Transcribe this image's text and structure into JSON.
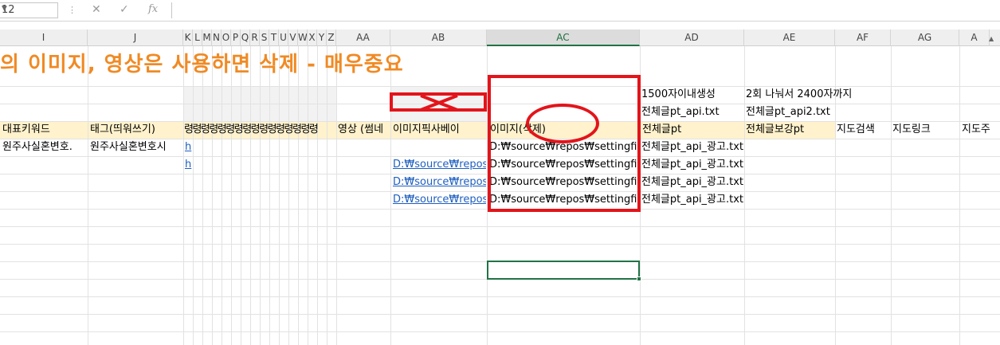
{
  "formula_bar": {
    "name_box_value": "12",
    "cancel_icon": "close-icon",
    "enter_icon": "check-icon",
    "function_icon": "fx-icon",
    "formula_value": ""
  },
  "columns": [
    "I",
    "J",
    "K",
    "L",
    "M",
    "N",
    "O",
    "P",
    "Q",
    "R",
    "S",
    "T",
    "U",
    "V",
    "W",
    "X",
    "Y",
    "Z",
    "AA",
    "AB",
    "AC",
    "AD",
    "AE",
    "AF",
    "AG",
    "A"
  ],
  "selected_column": "AC",
  "rows": {
    "title": "의 이미지, 영상은 사용하면 삭제 - 매우중요",
    "notes_row1": {
      "ad": "1500자이내생성",
      "ae": "2회 나눠서 2400자까지"
    },
    "notes_row2": {
      "ad": "전체글pt_api.txt",
      "ae": "전체글pt_api2.txt"
    },
    "headers": {
      "i": "대표키워드",
      "j": "태그(띄워쓰기)",
      "k_z": "령령령령령령령령령령령령령령령령",
      "aa": "영상 (썸네",
      "ab": "이미지픽사베이",
      "ac": "이미지(삭제)",
      "ad": "전체글pt",
      "ae": "전체글보강pt",
      "af": "지도검색",
      "ag": "지도링크",
      "ah": "지도주"
    },
    "data": [
      {
        "i": "원주사실혼변호.",
        "j": "원주사실혼변호시",
        "k": "h",
        "ab": "",
        "ac": "D:₩source₩repos₩settingfil",
        "ad": "전체글pt_api_광고.txt"
      },
      {
        "i": "",
        "j": "",
        "k": "h",
        "ab": "D:₩source₩repos",
        "ac": "D:₩source₩repos₩settingfil",
        "ad": "전체글pt_api_광고.txt"
      },
      {
        "i": "",
        "j": "",
        "k": "",
        "ab": "D:₩source₩repos",
        "ac": "D:₩source₩repos₩settingfil",
        "ad": "전체글pt_api_광고.txt"
      },
      {
        "i": "",
        "j": "",
        "k": "",
        "ab": "D:₩source₩repos",
        "ac": "D:₩source₩repos₩settingfil",
        "ad": "전체글pt_api_광고.txt"
      }
    ]
  },
  "colors": {
    "title": "#f08a24",
    "header_fill": "#fff2cc",
    "annotation": "#e3141b",
    "selection": "#217346",
    "link": "#1f5fbf"
  }
}
